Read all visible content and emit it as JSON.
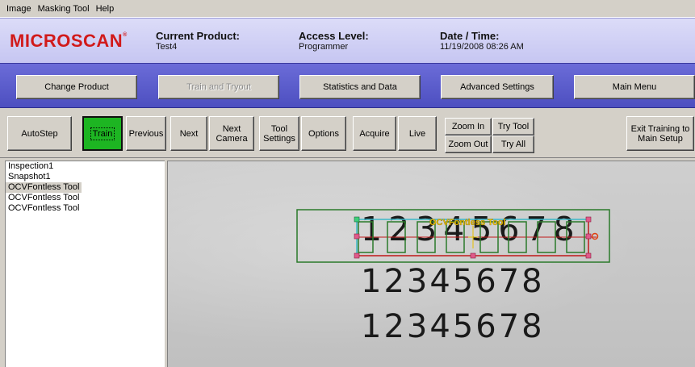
{
  "menu": [
    "Image",
    "Masking Tool",
    "Help"
  ],
  "header": {
    "brand": "MICROSCAN",
    "brand_mark": "®",
    "product_label": "Current Product:",
    "product_value": "Test4",
    "access_label": "Access Level:",
    "access_value": "Programmer",
    "datetime_label": "Date / Time:",
    "datetime_value": "11/19/2008 08:26 AM"
  },
  "nav": {
    "change_product": "Change Product",
    "train_tryout": "Train and Tryout",
    "statistics": "Statistics and Data",
    "advanced": "Advanced Settings",
    "main_menu": "Main Menu"
  },
  "toolbar": {
    "autostep": "AutoStep",
    "train": "Train",
    "previous": "Previous",
    "next": "Next",
    "next_camera": "Next Camera",
    "tool_settings": "Tool Settings",
    "options": "Options",
    "acquire": "Acquire",
    "live": "Live",
    "zoom_in": "Zoom In",
    "zoom_out": "Zoom Out",
    "try_tool": "Try Tool",
    "try_all": "Try All",
    "exit_training": "Exit Training to Main Setup"
  },
  "tree": [
    "Inspection1",
    "Snapshot1",
    "OCVFontless Tool",
    "OCVFontless Tool",
    "OCVFontless Tool"
  ],
  "image": {
    "tool_label": "OCVFontless Tool",
    "row1": "12345678",
    "row2": "12345678",
    "row3": "12345678"
  },
  "colors": {
    "brand_red": "#d11a1a",
    "train_green": "#1db522",
    "nav_blue": "#5557c8",
    "roi_green": "#2a7a2a",
    "tool_yellow": "#e8c000"
  }
}
